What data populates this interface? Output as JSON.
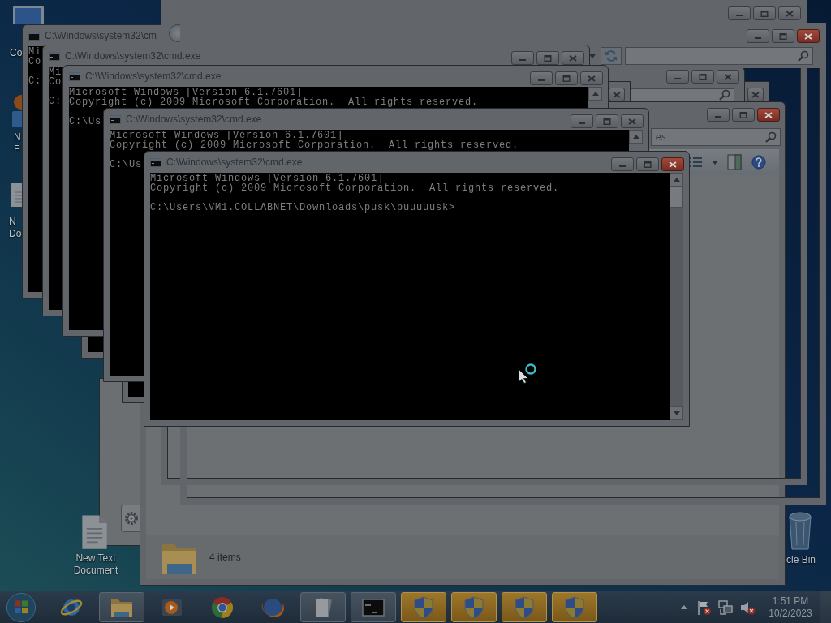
{
  "desktop_icons": [
    {
      "kind": "computer",
      "lines": [
        "Co"
      ]
    },
    {
      "kind": "app",
      "lines": [
        "N",
        "F"
      ]
    },
    {
      "kind": "document",
      "lines": [
        "N",
        "Do"
      ]
    },
    {
      "kind": "document",
      "lines": [
        "New Text",
        "Document"
      ]
    },
    {
      "kind": "recycle",
      "lines": [
        "cle Bin"
      ]
    }
  ],
  "explorer_windows": [
    {
      "kind": "panel",
      "buttons": [
        {
          "kind": "gear"
        }
      ]
    },
    {
      "kind": "sliver",
      "active": false
    },
    {
      "kind": "folder",
      "active": false,
      "address_bar": [
        {
          "kind": "search"
        }
      ]
    },
    {
      "kind": "sliver",
      "active": false
    },
    {
      "kind": "folder",
      "active": true,
      "address_bar": [
        {
          "kind": "search",
          "placeholder": "es"
        }
      ],
      "command_bar": [
        {
          "kind": "views"
        },
        {
          "kind": "dropdown"
        },
        {
          "kind": "preview"
        },
        {
          "kind": "help"
        }
      ],
      "status": "4 items"
    },
    {
      "kind": "frame",
      "active": false,
      "address_bar": [
        {
          "kind": "back"
        }
      ]
    },
    {
      "kind": "frame",
      "active": true,
      "address_bar": [
        {
          "kind": "history"
        },
        {
          "kind": "refresh"
        },
        {
          "kind": "search"
        }
      ]
    }
  ],
  "console_windows": [
    {
      "kind": "window",
      "title": "C:\\Windows\\system32\\cm",
      "lines": [
        "Mi",
        "Co"
      ],
      "prompt": "C:"
    },
    {
      "kind": "frame"
    },
    {
      "kind": "window",
      "active": false,
      "title": "C:\\Windows\\system32\\cmd.exe",
      "lines": [
        "Mi",
        "Co"
      ],
      "prompt": "C:"
    },
    {
      "kind": "window",
      "active": false,
      "title": "C:\\Windows\\system32\\cmd.exe",
      "lines": [
        "Microsoft Windows [Version 6.1.7601]",
        "Copyright (c) 2009 Microsoft Corporation.  All rights reserved."
      ],
      "prompt": "C:\\Us"
    },
    {
      "kind": "frame"
    },
    {
      "kind": "window",
      "active": false,
      "title": "C:\\Windows\\system32\\cmd.exe",
      "lines": [
        "Microsoft Windows [Version 6.1.7601]",
        "Copyright (c) 2009 Microsoft Corporation.  All rights reserved."
      ],
      "prompt": "C:\\Us"
    },
    {
      "kind": "window",
      "active": true,
      "title": "C:\\Windows\\system32\\cmd.exe",
      "lines": [
        "Microsoft Windows [Version 6.1.7601]",
        "Copyright (c) 2009 Microsoft Corporation.  All rights reserved."
      ],
      "prompt": "C:\\Users\\VM1.COLLABNET\\Downloads\\pusk\\puuuuusk>"
    }
  ],
  "taskbar": {
    "items": [
      {
        "kind": "ie",
        "running": false,
        "flashing": false
      },
      {
        "kind": "folder",
        "running": true,
        "flashing": false
      },
      {
        "kind": "media",
        "running": false,
        "flashing": false
      },
      {
        "kind": "chrome",
        "running": false,
        "flashing": false
      },
      {
        "kind": "firefox",
        "running": false,
        "flashing": false
      },
      {
        "kind": "notepad",
        "running": true,
        "flashing": false
      },
      {
        "kind": "console",
        "running": true,
        "flashing": false
      },
      {
        "kind": "shield",
        "running": true,
        "flashing": true
      },
      {
        "kind": "shield",
        "running": true,
        "flashing": true
      },
      {
        "kind": "shield",
        "running": true,
        "flashing": true
      },
      {
        "kind": "shield",
        "running": true,
        "flashing": true
      }
    ],
    "tray": [
      {
        "kind": "overflow"
      },
      {
        "kind": "flag"
      },
      {
        "kind": "network"
      },
      {
        "kind": "volume",
        "muted": true
      }
    ],
    "time": "1:51 PM",
    "date": "10/2/2023"
  }
}
